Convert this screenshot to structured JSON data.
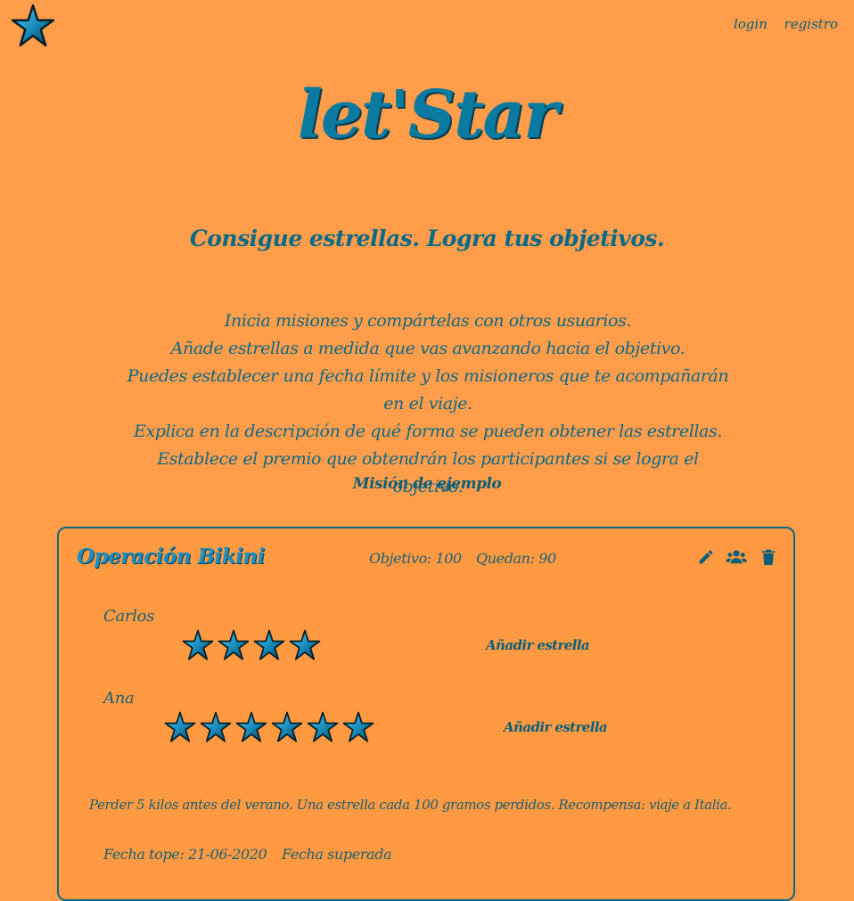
{
  "nav": {
    "login": "login",
    "register": "registro"
  },
  "brand": {
    "title": "let'Star"
  },
  "tagline": "Consigue estrellas. Logra tus objetivos.",
  "intro": [
    "Inicia misiones y compártelas con otros usuarios.",
    "Añade estrellas a medida que vas avanzando hacia el objetivo.",
    "Puedes establecer una fecha límite y los misioneros que te acompañarán en el viaje.",
    "Explica en la descripción de qué forma se pueden obtener las estrellas. Establece el premio que obtendrán los participantes si se logra el objetivo."
  ],
  "example_label": "Misión de ejemplo",
  "mission": {
    "title": "Operación Bikini",
    "goal": "Objetivo: 100",
    "remaining": "Quedan: 90",
    "participants": [
      {
        "name": "Carlos",
        "stars": 4,
        "add_label": "Añadir estrella"
      },
      {
        "name": "Ana",
        "stars": 6,
        "add_label": "Añadir estrella"
      }
    ],
    "description": "Perder 5 kilos antes del verano. Una estrella cada 100 gramos perdidos. Recompensa: viaje a Italia.",
    "deadline": "Fecha tope: 21-06-2020",
    "achieved": "Fecha superada"
  },
  "icons": {
    "logo": "star-icon",
    "edit": "pencil-icon",
    "members": "users-icon",
    "delete": "trash-icon"
  },
  "colors": {
    "background": "#ff9d4a",
    "accent": "#0b7aa0",
    "text": "#0a6a86",
    "star_fill": "#1ea0d8"
  }
}
